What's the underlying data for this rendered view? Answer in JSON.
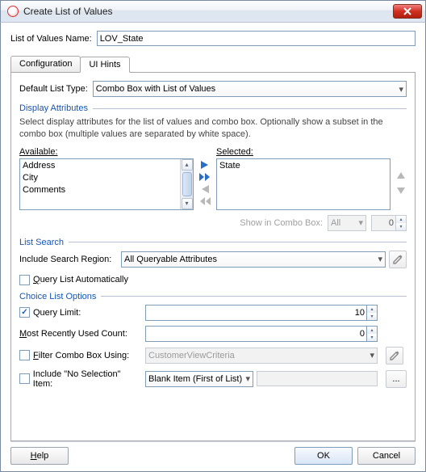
{
  "window": {
    "title": "Create List of Values"
  },
  "nameRow": {
    "label": "List of Values Name:",
    "value": "LOV_State"
  },
  "tabs": {
    "configuration": "Configuration",
    "uihints": "UI Hints"
  },
  "defaultListType": {
    "label": "Default List Type:",
    "value": "Combo Box with List of Values"
  },
  "displayAttributes": {
    "title": "Display Attributes",
    "hint": "Select display attributes for the list of values and combo box. Optionally show a subset in the combo box (multiple values are separated by white space).",
    "availableLabel": "Available:",
    "selectedLabel": "Selected:",
    "available": [
      "Address",
      "City",
      "Comments"
    ],
    "selected": [
      "State"
    ],
    "showInComboLabel": "Show in Combo Box:",
    "showInComboSelect": "All",
    "showInComboCount": "0"
  },
  "listSearch": {
    "title": "List Search",
    "includeRegionLabel": "Include Search Region:",
    "includeRegionValue": "All Queryable Attributes",
    "queryAutoLabel": "Query List Automatically"
  },
  "choiceListOptions": {
    "title": "Choice List Options",
    "queryLimitLabel": "Query Limit:",
    "queryLimitValue": "10",
    "mruLabel": "Most Recently Used Count:",
    "mruValue": "0",
    "filterLabel": "Filter Combo Box Using:",
    "filterValue": "CustomerViewCriteria",
    "noSelectLabel": "Include \"No Selection\" Item:",
    "noSelectValue": "Blank Item (First of List)",
    "moreBtn": "..."
  },
  "buttons": {
    "help": "Help",
    "ok": "OK",
    "cancel": "Cancel"
  }
}
